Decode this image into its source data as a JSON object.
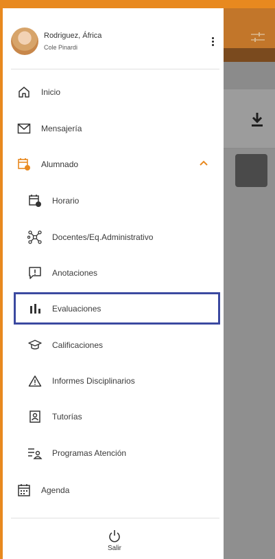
{
  "profile": {
    "name": "Rodriguez, África",
    "subtitle": "Cole Pinardi"
  },
  "menu": [
    {
      "label": "Inicio",
      "icon": "home-icon"
    },
    {
      "label": "Mensajería",
      "icon": "mail-icon"
    },
    {
      "label": "Alumnado",
      "icon": "calendar-clock-icon",
      "expanded": true,
      "accent": "#e8891f"
    }
  ],
  "submenu": [
    {
      "label": "Horario",
      "icon": "schedule-icon"
    },
    {
      "label": "Docentes/Eq.Administrativo",
      "icon": "network-icon"
    },
    {
      "label": "Anotaciones",
      "icon": "alert-comment-icon"
    },
    {
      "label": "Evaluaciones",
      "icon": "bar-chart-icon",
      "highlighted": true
    },
    {
      "label": "Calificaciones",
      "icon": "graduation-cap-icon"
    },
    {
      "label": "Informes Disciplinarios",
      "icon": "warning-icon"
    },
    {
      "label": "Tutorías",
      "icon": "badge-icon"
    },
    {
      "label": "Programas Atención",
      "icon": "person-list-icon"
    }
  ],
  "agenda": {
    "label": "Agenda",
    "icon": "agenda-icon"
  },
  "logout": {
    "label": "Salir",
    "icon": "power-icon"
  },
  "colors": {
    "accent": "#e8891f",
    "highlight": "#3b49a0"
  }
}
